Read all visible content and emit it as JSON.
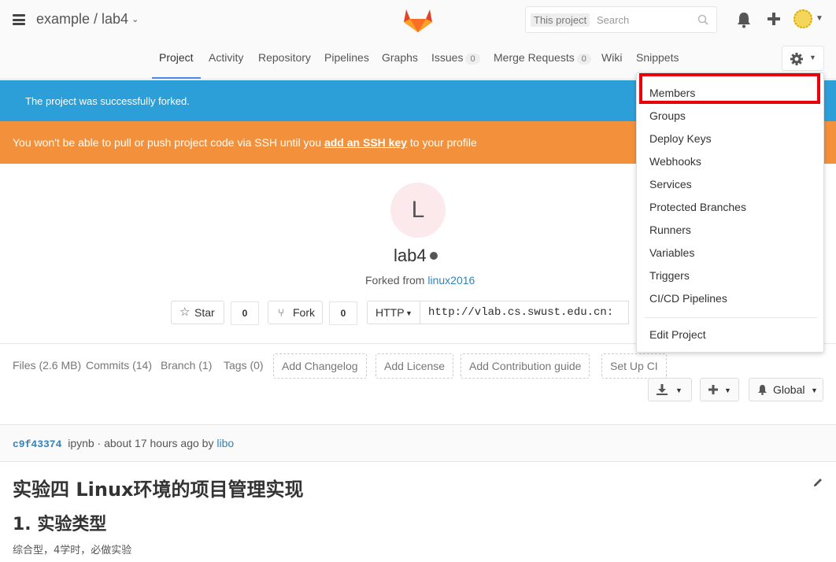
{
  "header": {
    "breadcrumb": "example / lab4",
    "breadcrumb_chevron": "⌄",
    "search_scope": "This project",
    "search_placeholder": "Search"
  },
  "nav": {
    "tabs": [
      {
        "label": "Project",
        "active": true
      },
      {
        "label": "Activity"
      },
      {
        "label": "Repository"
      },
      {
        "label": "Pipelines"
      },
      {
        "label": "Graphs"
      },
      {
        "label": "Issues",
        "badge": "0"
      },
      {
        "label": "Merge Requests",
        "badge": "0"
      },
      {
        "label": "Wiki"
      },
      {
        "label": "Snippets"
      }
    ]
  },
  "flash": {
    "notice": "The project was successfully forked.",
    "warning_prefix": "You won't be able to pull or push project code via SSH until you ",
    "warning_link": "add an SSH key",
    "warning_suffix": " to your profile"
  },
  "project": {
    "avatar_letter": "L",
    "name": "lab4",
    "forked_from_label": "Forked from ",
    "forked_from_link": "linux2016",
    "star_label": "Star",
    "star_count": "0",
    "fork_label": "Fork",
    "fork_count": "0",
    "protocol": "HTTP",
    "clone_url": "http://vlab.cs.swust.edu.cn:"
  },
  "stats": {
    "files": "Files (2.6 MB)",
    "commits": "Commits (14)",
    "branch": "Branch (1)",
    "tags": "Tags (0)",
    "add_changelog": "Add Changelog",
    "add_license": "Add License",
    "add_contribution": "Add Contribution guide",
    "setup_ci": "Set Up CI",
    "notification": "Global"
  },
  "commit": {
    "sha": "c9f43374",
    "message": "ipynb · about 17 hours ago by ",
    "author": "libo"
  },
  "readme": {
    "h1": "实验四 Linux环境的项目管理实现",
    "h2": "1. 实验类型",
    "p": "综合型，4学时，必做实验"
  },
  "settings_menu": {
    "items": [
      "Members",
      "Groups",
      "Deploy Keys",
      "Webhooks",
      "Services",
      "Protected Branches",
      "Runners",
      "Variables",
      "Triggers",
      "CI/CD Pipelines"
    ],
    "footer": "Edit Project",
    "highlighted": "Members",
    "highlight_color": "#e8000b"
  },
  "colors": {
    "notice_bg": "#2d9fd8",
    "warning_bg": "#f2903b",
    "link": "#3084bb"
  }
}
